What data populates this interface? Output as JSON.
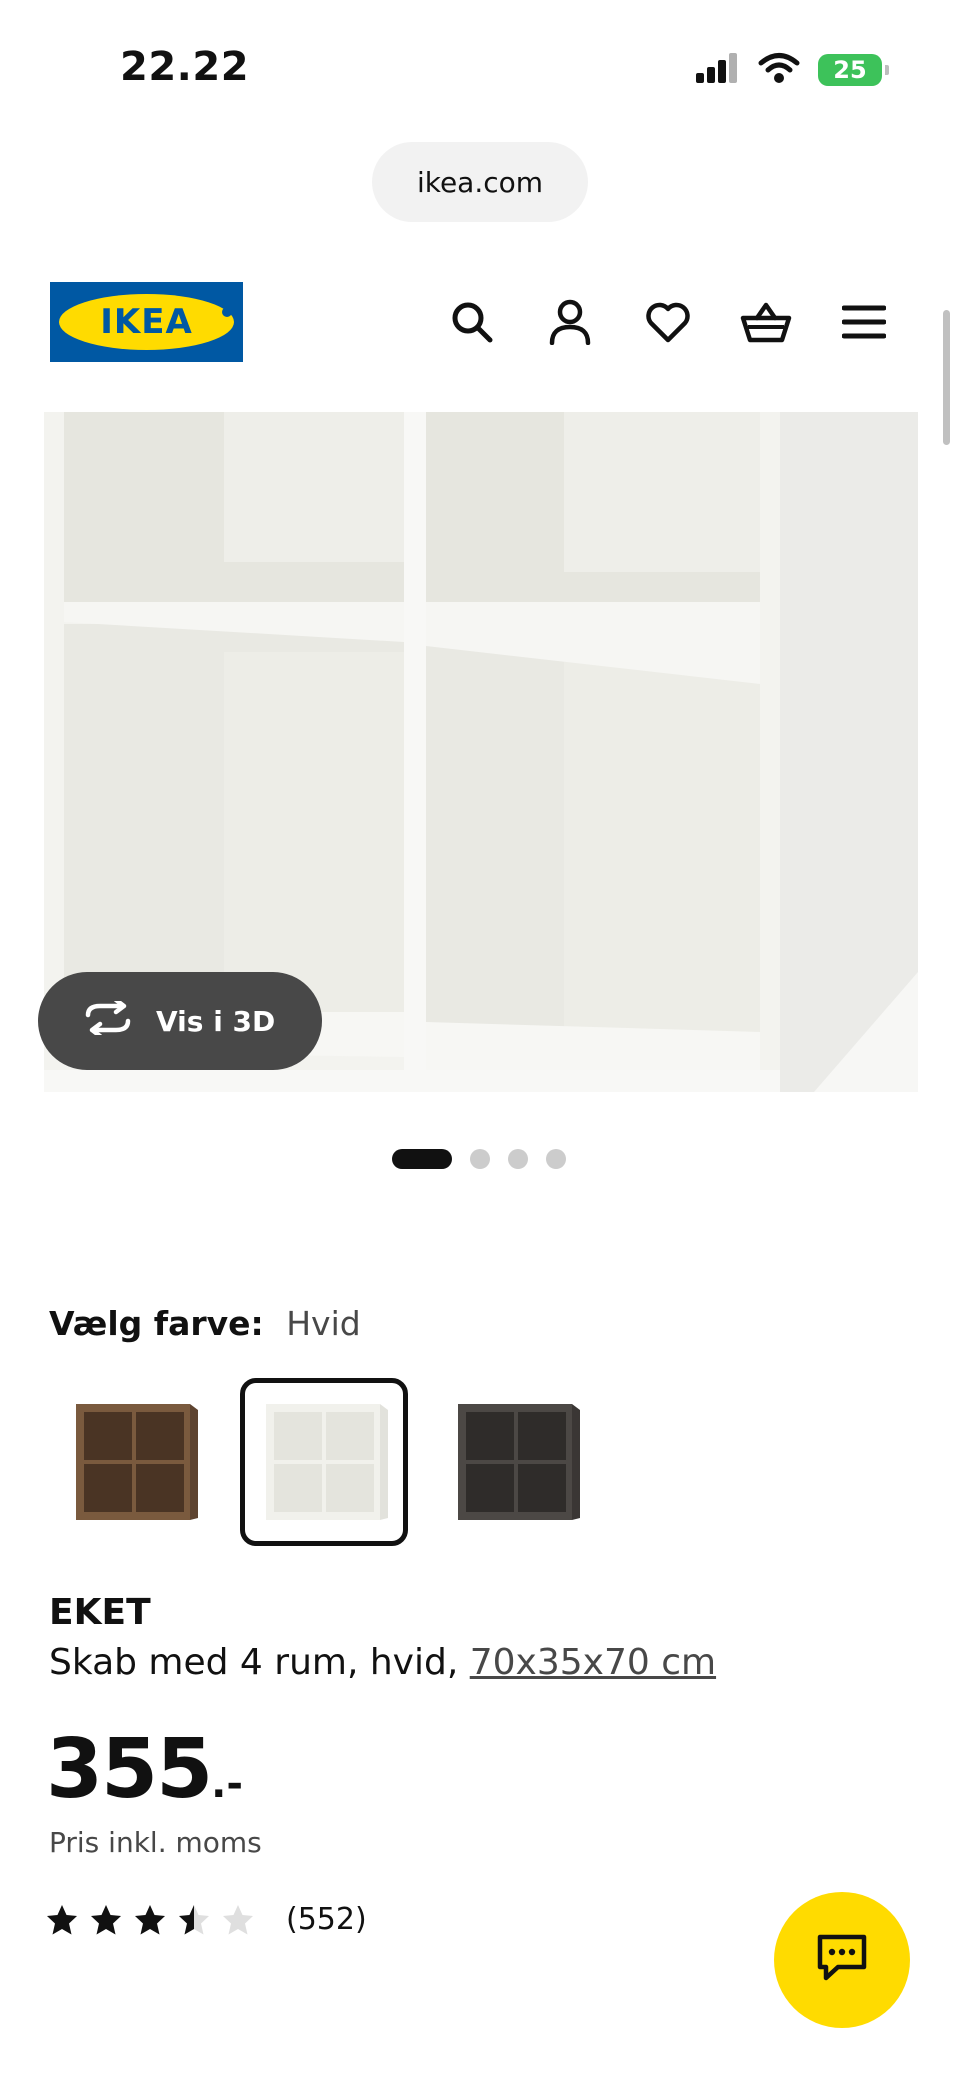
{
  "status_bar": {
    "time": "22.22",
    "battery": "25",
    "icons": [
      "signal-icon",
      "wifi-icon",
      "battery-icon"
    ]
  },
  "browser": {
    "url": "ikea.com"
  },
  "header": {
    "logo_text": "IKEA",
    "icons": [
      "search-icon",
      "account-icon",
      "heart-icon",
      "basket-icon",
      "menu-icon"
    ]
  },
  "gallery": {
    "view_3d_label": "Vis i 3D",
    "page_count": 4,
    "current_page": 1
  },
  "color_selection": {
    "label": "Vælg farve:",
    "selected": "Hvid",
    "swatches": [
      {
        "name": "walnut",
        "color": "#7a5a3e"
      },
      {
        "name": "white",
        "color": "#f1f1ec"
      },
      {
        "name": "dark-grey",
        "color": "#4c4845"
      }
    ]
  },
  "product": {
    "name": "EKET",
    "description": "Skab med 4 rum, hvid, ",
    "size": "70x35x70 cm",
    "price_integer": "355",
    "price_suffix": ".-",
    "price_note": "Pris inkl. moms",
    "rating": 3.5,
    "rating_max": 5,
    "review_count": "(552)"
  },
  "colors": {
    "ikea_blue": "#0058a3",
    "ikea_yellow": "#ffdb00",
    "text": "#111111",
    "muted": "#484848",
    "star_empty": "#dfdfdf"
  }
}
